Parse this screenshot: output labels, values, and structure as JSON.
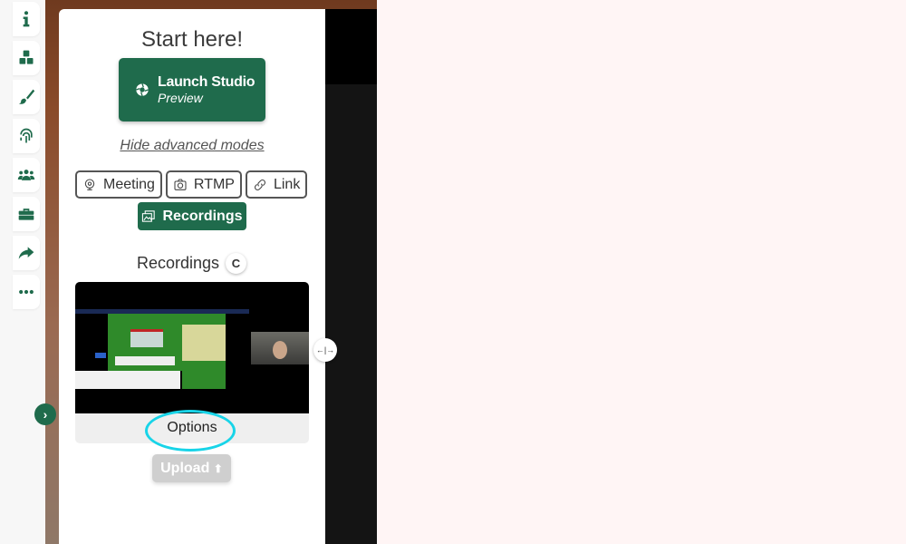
{
  "sidebar": {
    "icons": [
      {
        "name": "info-icon",
        "label": "Info"
      },
      {
        "name": "cubes-icon",
        "label": "Sources"
      },
      {
        "name": "paintbrush-icon",
        "label": "Style"
      },
      {
        "name": "fingerprint-icon",
        "label": "Identity"
      },
      {
        "name": "users-icon",
        "label": "Guests"
      },
      {
        "name": "toolbox-icon",
        "label": "Tools"
      },
      {
        "name": "share-icon",
        "label": "Share"
      },
      {
        "name": "more-icon",
        "label": "More"
      }
    ],
    "toggle_glyph": "›"
  },
  "panel": {
    "title": "Start here!",
    "launch": {
      "main": "Launch Studio",
      "sub": "Preview"
    },
    "hide_link": "Hide advanced modes",
    "modes": [
      {
        "label": "Meeting",
        "icon": "webcam-icon"
      },
      {
        "label": "RTMP",
        "icon": "camera-icon"
      },
      {
        "label": "Link",
        "icon": "link-icon"
      }
    ],
    "active_mode": {
      "label": "Recordings",
      "icon": "recordings-icon"
    },
    "recordings_heading": "Recordings",
    "refresh_glyph": "C",
    "recording_card": {
      "options_label": "Options"
    },
    "upload_label": "Upload",
    "upload_glyph": "⬆"
  },
  "resize_glyph": "←|→",
  "colors": {
    "brand": "#1f6b4c",
    "highlight": "#18d4e8",
    "background": "#fff5f5"
  }
}
